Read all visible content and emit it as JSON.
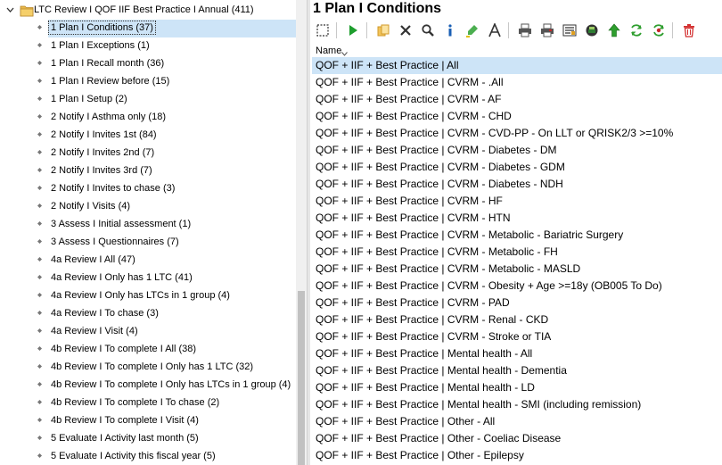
{
  "tree": {
    "root": {
      "label": "LTC Review I QOF IIF Best Practice I Annual (411)",
      "expanded": true,
      "icon": "folder-icon"
    },
    "selected_index": 0,
    "items": [
      {
        "label": "1 Plan I Conditions (37)"
      },
      {
        "label": "1 Plan I Exceptions (1)"
      },
      {
        "label": "1 Plan I Recall month (36)"
      },
      {
        "label": "1 Plan I Review before (15)"
      },
      {
        "label": "1 Plan I Setup (2)"
      },
      {
        "label": "2 Notify I Asthma only (18)"
      },
      {
        "label": "2 Notify I Invites 1st (84)"
      },
      {
        "label": "2 Notify I Invites 2nd (7)"
      },
      {
        "label": "2 Notify I Invites 3rd (7)"
      },
      {
        "label": "2 Notify I Invites to chase (3)"
      },
      {
        "label": "2 Notify I Visits (4)"
      },
      {
        "label": "3 Assess I Initial assessment (1)"
      },
      {
        "label": "3 Assess I Questionnaires (7)"
      },
      {
        "label": "4a Review I All (47)"
      },
      {
        "label": "4a Review I Only has 1 LTC (41)"
      },
      {
        "label": "4a Review I Only has LTCs in 1 group (4)"
      },
      {
        "label": "4a Review I To chase (3)"
      },
      {
        "label": "4a Review I Visit (4)"
      },
      {
        "label": "4b Review I To complete I All (38)"
      },
      {
        "label": "4b Review I To complete I Only has 1 LTC (32)"
      },
      {
        "label": "4b Review I To complete I Only has LTCs in 1 group (4)"
      },
      {
        "label": "4b Review I To complete I To chase (2)"
      },
      {
        "label": "4b Review I To complete I Visit (4)"
      },
      {
        "label": "5 Evaluate I Activity last month (5)"
      },
      {
        "label": "5 Evaluate I Activity this fiscal year (5)"
      }
    ]
  },
  "panel": {
    "title": "1 Plan I Conditions",
    "toolbar": [
      {
        "icon": "select-box-icon",
        "color": "#333333"
      },
      {
        "sep": true
      },
      {
        "icon": "run-icon",
        "color": "#1e9e2e"
      },
      {
        "sep": true
      },
      {
        "icon": "copy-icon",
        "color": "#d19a2a"
      },
      {
        "icon": "delete-x-icon",
        "color": "#333333"
      },
      {
        "icon": "search-icon",
        "color": "#333333"
      },
      {
        "icon": "info-icon",
        "color": "#1a5fb4"
      },
      {
        "icon": "highlight-icon",
        "color": "#4caf50"
      },
      {
        "icon": "font-icon",
        "color": "#333333"
      },
      {
        "sep": true
      },
      {
        "icon": "print-icon",
        "color": "#555555"
      },
      {
        "icon": "print-red-icon",
        "color": "#c62828"
      },
      {
        "icon": "list-config-icon",
        "color": "#333333"
      },
      {
        "icon": "report-icon",
        "color": "#2e7d32"
      },
      {
        "icon": "arrow-up-icon",
        "color": "#2e9e2e"
      },
      {
        "icon": "refresh-icon",
        "color": "#2e9e2e"
      },
      {
        "icon": "refresh-red-icon",
        "color": "#c62828"
      },
      {
        "sep": true
      },
      {
        "icon": "trash-icon",
        "color": "#d32f2f"
      }
    ],
    "column_header": "Name",
    "selected_row": 0,
    "rows": [
      "QOF + IIF + Best Practice | All",
      "QOF + IIF + Best Practice | CVRM - .All",
      "QOF + IIF + Best Practice | CVRM - AF",
      "QOF + IIF + Best Practice | CVRM - CHD",
      "QOF + IIF + Best Practice | CVRM - CVD-PP - On LLT or QRISK2/3 >=10%",
      "QOF + IIF + Best Practice | CVRM - Diabetes - DM",
      "QOF + IIF + Best Practice | CVRM - Diabetes - GDM",
      "QOF + IIF + Best Practice | CVRM - Diabetes - NDH",
      "QOF + IIF + Best Practice | CVRM - HF",
      "QOF + IIF + Best Practice | CVRM - HTN",
      "QOF + IIF + Best Practice | CVRM - Metabolic - Bariatric Surgery",
      "QOF + IIF + Best Practice | CVRM - Metabolic - FH",
      "QOF + IIF + Best Practice | CVRM - Metabolic - MASLD",
      "QOF + IIF + Best Practice | CVRM - Obesity + Age >=18y (OB005 To Do)",
      "QOF + IIF + Best Practice | CVRM - PAD",
      "QOF + IIF + Best Practice | CVRM - Renal - CKD",
      "QOF + IIF + Best Practice | CVRM - Stroke or TIA",
      "QOF + IIF + Best Practice | Mental health - All",
      "QOF + IIF + Best Practice | Mental health - Dementia",
      "QOF + IIF + Best Practice | Mental health - LD",
      "QOF + IIF + Best Practice | Mental health - SMI (including remission)",
      "QOF + IIF + Best Practice | Other - All",
      "QOF + IIF + Best Practice | Other - Coeliac Disease",
      "QOF + IIF + Best Practice | Other - Epilepsy"
    ]
  },
  "colors": {
    "selection": "#cde4f7",
    "scrollbar_track": "#f0f0f0",
    "scrollbar_thumb": "#c1c1c1"
  },
  "scroll": {
    "tree_scroll_fraction": 1.0
  }
}
